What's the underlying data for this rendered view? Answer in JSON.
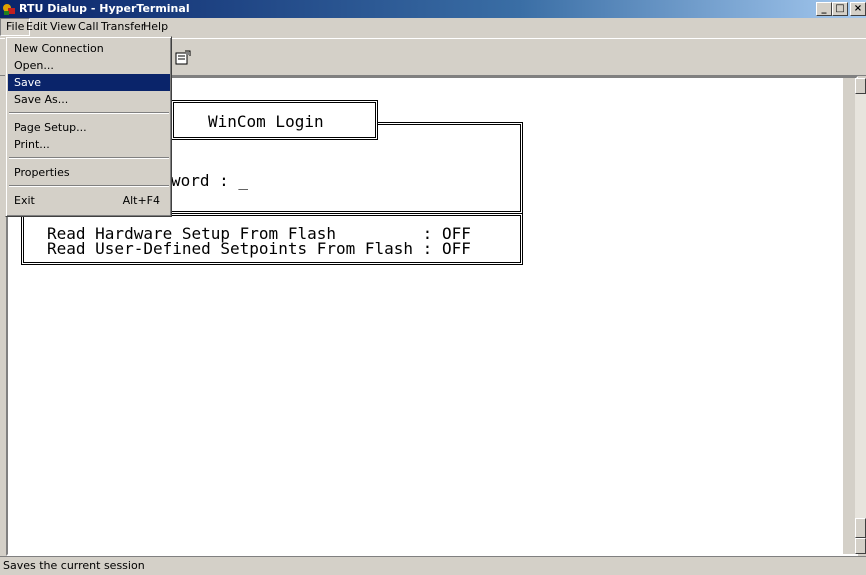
{
  "window": {
    "title": "RTU Dialup - HyperTerminal"
  },
  "menubar": {
    "file": "File",
    "edit": "Edit",
    "view": "View",
    "call": "Call",
    "transfer": "Transfer",
    "help": "Help"
  },
  "file_menu": {
    "new_connection": "New Connection",
    "open": "Open...",
    "save": "Save",
    "save_as": "Save As...",
    "page_setup": "Page Setup...",
    "print": "Print...",
    "properties": "Properties",
    "exit": "Exit",
    "exit_shortcut": "Alt+F4",
    "selected": "Save"
  },
  "terminal": {
    "login_title": "WinCom Login",
    "password_line": "word : _",
    "line1": "Read Hardware Setup From Flash         : OFF",
    "line2": "Read User-Defined Setpoints From Flash : OFF"
  },
  "status": {
    "text": "Saves the current session"
  },
  "colors": {
    "titlebar": "#0a246a",
    "highlight": "#0a246a",
    "chrome": "#d4d0c8"
  }
}
